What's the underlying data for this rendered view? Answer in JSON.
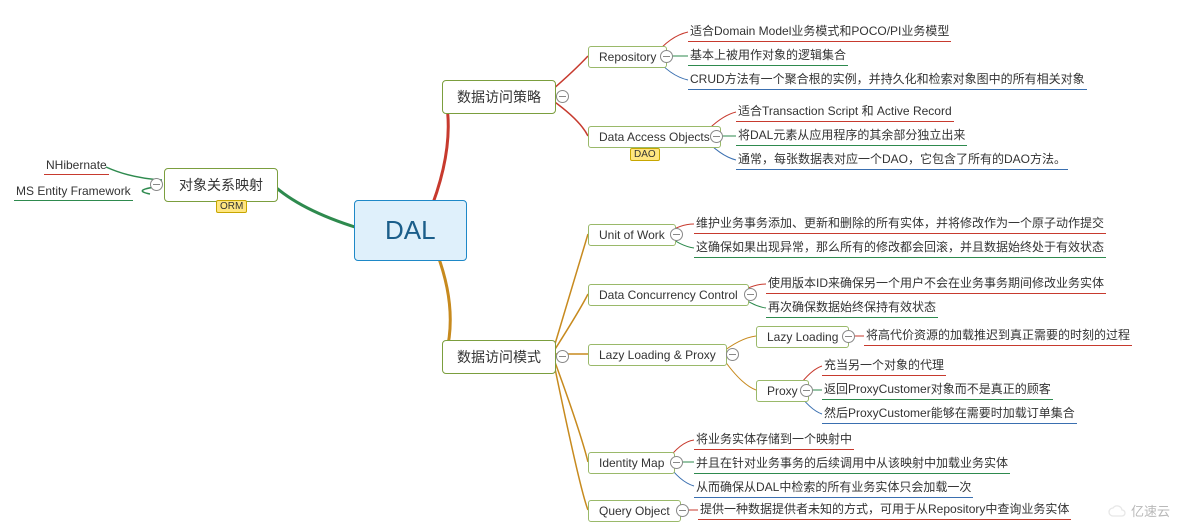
{
  "root": "DAL",
  "watermark": "亿速云",
  "left": {
    "orm": {
      "label": "对象关系映射",
      "tag": "ORM",
      "children": [
        "NHibernate",
        "MS Entity Framework"
      ]
    }
  },
  "right": {
    "strategy": {
      "label": "数据访问策略",
      "repository": {
        "label": "Repository",
        "items": [
          "适合Domain Model业务模式和POCO/PI业务模型",
          "基本上被用作对象的逻辑集合",
          "CRUD方法有一个聚合根的实例，并持久化和检索对象图中的所有相关对象"
        ]
      },
      "dao": {
        "label": "Data Access Objects",
        "tag": "DAO",
        "items": [
          "适合Transaction Script 和 Active Record",
          "将DAL元素从应用程序的其余部分独立出来",
          "通常，每张数据表对应一个DAO，它包含了所有的DAO方法。"
        ]
      }
    },
    "pattern": {
      "label": "数据访问模式",
      "uow": {
        "label": "Unit of Work",
        "items": [
          "维护业务事务添加、更新和删除的所有实体，并将修改作为一个原子动作提交",
          "这确保如果出现异常，那么所有的修改都会回滚，并且数据始终处于有效状态"
        ]
      },
      "dcc": {
        "label": "Data Concurrency Control",
        "items": [
          "使用版本ID来确保另一个用户不会在业务事务期间修改业务实体",
          "再次确保数据始终保持有效状态"
        ]
      },
      "lazy": {
        "label": "Lazy Loading & Proxy",
        "ll": {
          "label": "Lazy Loading",
          "text": "将高代价资源的加载推迟到真正需要的时刻的过程"
        },
        "proxy": {
          "label": "Proxy",
          "items": [
            "充当另一个对象的代理",
            "返回ProxyCustomer对象而不是真正的顾客",
            "然后ProxyCustomer能够在需要时加载订单集合"
          ]
        }
      },
      "idmap": {
        "label": "Identity Map",
        "items": [
          "将业务实体存储到一个映射中",
          "并且在针对业务事务的后续调用中从该映射中加载业务实体",
          "从而确保从DAL中检索的所有业务实体只会加载一次"
        ]
      },
      "query": {
        "label": "Query Object",
        "text": "提供一种数据提供者未知的方式，可用于从Repository中查询业务实体"
      }
    }
  },
  "colors": {
    "c1": "#c73a2e",
    "c2": "#2e8a4e",
    "c3": "#3a6fb0",
    "c4": "#c78a1e",
    "c5": "#5a3fb0"
  }
}
